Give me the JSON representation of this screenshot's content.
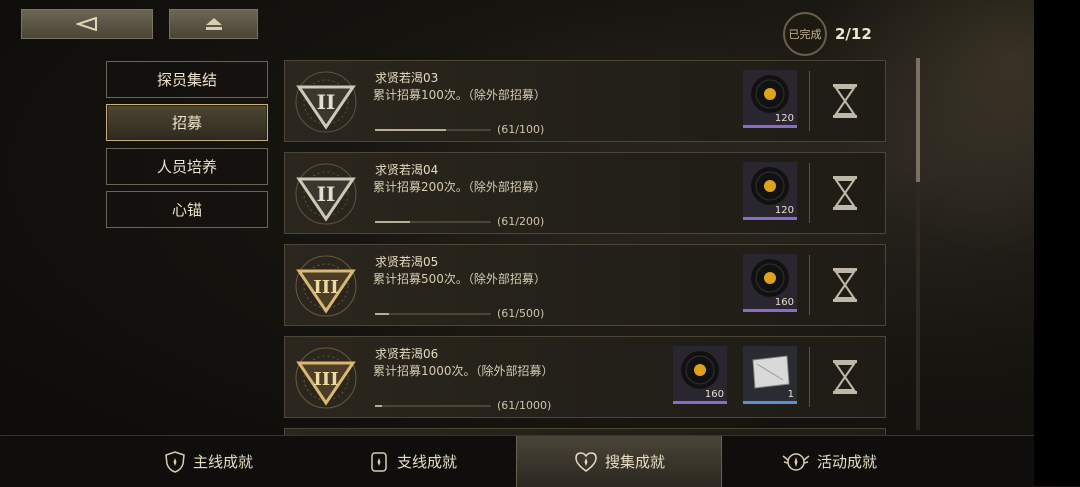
{
  "nav": {
    "back_icon": "back-arrow-icon",
    "home_icon": "eject-home-icon"
  },
  "progress": {
    "label": "已完成",
    "count": "2/12"
  },
  "categories": [
    {
      "label": "探员集结",
      "active": false
    },
    {
      "label": "招募",
      "active": true
    },
    {
      "label": "人员培养",
      "active": false
    },
    {
      "label": "心锚",
      "active": false
    }
  ],
  "achievements": [
    {
      "title": "求贤若渴03",
      "desc": "累计招募100次。（除外部招募）",
      "progress_text": "(61/100)",
      "progress": 0.61,
      "tier": "II",
      "rewards": [
        {
          "icon": "vinyl-record-icon",
          "count": "120",
          "rarity": "purple"
        }
      ]
    },
    {
      "title": "求贤若渴04",
      "desc": "累计招募200次。（除外部招募）",
      "progress_text": "(61/200)",
      "progress": 0.305,
      "tier": "II",
      "rewards": [
        {
          "icon": "vinyl-record-icon",
          "count": "120",
          "rarity": "purple"
        }
      ]
    },
    {
      "title": "求贤若渴05",
      "desc": "累计招募500次。（除外部招募）",
      "progress_text": "(61/500)",
      "progress": 0.122,
      "tier": "III",
      "rewards": [
        {
          "icon": "vinyl-record-icon",
          "count": "160",
          "rarity": "purple"
        }
      ]
    },
    {
      "title": "求贤若渴06",
      "desc": "累计招募1000次。（除外部招募）",
      "progress_text": "(61/1000)",
      "progress": 0.061,
      "tier": "III",
      "rewards": [
        {
          "icon": "vinyl-record-icon",
          "count": "160",
          "rarity": "purple"
        },
        {
          "icon": "card-item-icon",
          "count": "1",
          "rarity": "blue"
        }
      ]
    }
  ],
  "tabs": [
    {
      "label": "主线成就",
      "icon": "shield-star-icon",
      "active": false
    },
    {
      "label": "支线成就",
      "icon": "badge-icon",
      "active": false
    },
    {
      "label": "搜集成就",
      "icon": "heart-star-icon",
      "active": true
    },
    {
      "label": "活动成就",
      "icon": "winged-star-icon",
      "active": false
    }
  ],
  "colors": {
    "accent": "#c8b07a",
    "purple_rarity": "#8a6cc8",
    "blue_rarity": "#5b8fcf"
  }
}
